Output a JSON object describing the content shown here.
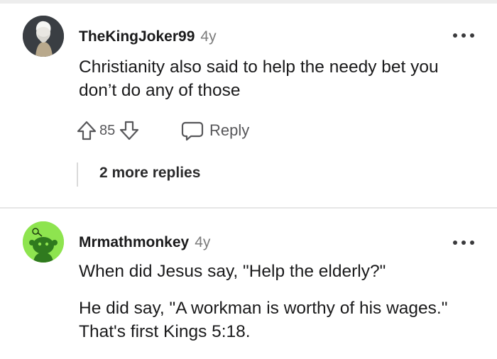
{
  "comments": [
    {
      "username": "TheKingJoker99",
      "age": "4y",
      "avatar_icon": "old-man-portrait-avatar",
      "paragraphs": [
        "Christianity also said to help the needy bet you don’t do any of those"
      ],
      "score": "85",
      "reply_label": "Reply",
      "more_replies_label": "2 more replies"
    },
    {
      "username": "Mrmathmonkey",
      "age": "4y",
      "avatar_icon": "snoo-alien-avatar",
      "paragraphs": [
        "When did Jesus say, \"Help the elderly?\"",
        "He did say, \"A workman is worthy of his wages.\" That's first Kings 5:18."
      ]
    }
  ],
  "colors": {
    "text_primary": "#1a1a1b",
    "text_secondary": "#7c7c7c",
    "icon_gray": "#57575a",
    "avatar_green": "#8ee44f"
  }
}
